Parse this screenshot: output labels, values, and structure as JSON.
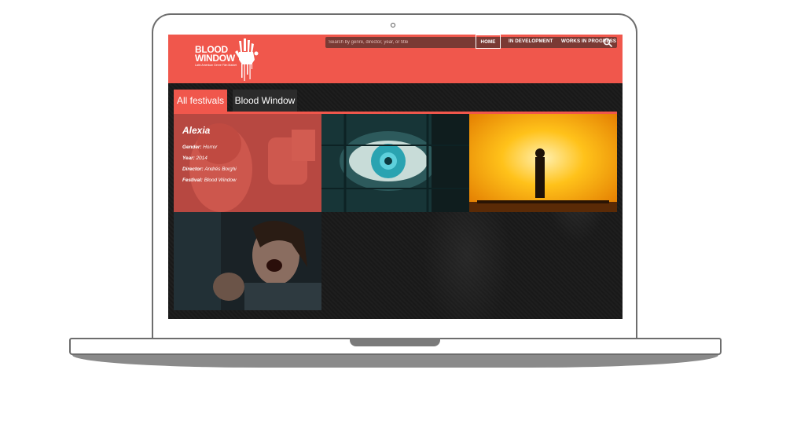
{
  "site": {
    "logo_title": "BLOOD\nWINDOW",
    "logo_tagline": "Latin American Genre Film Market",
    "search_placeholder": "Search by genre, director, year, or title"
  },
  "nav": [
    {
      "label": "HOME",
      "active": true
    },
    {
      "label": "IN DEVELOPMENT",
      "active": false
    },
    {
      "label": "WORKS IN PROGRESS",
      "active": false
    }
  ],
  "tabs": [
    {
      "label": "All festivals",
      "active": true
    },
    {
      "label": "Blood Window",
      "active": false
    }
  ],
  "films": [
    {
      "title": "Alexia",
      "gender_label": "Gender:",
      "gender": "Horror",
      "year_label": "Year:",
      "year": "2014",
      "director_label": "Director:",
      "director": "Andrés Borghi",
      "festival_label": "Festival:",
      "festival": "Blood Window"
    }
  ],
  "colors": {
    "brand": "#f0574c",
    "dark_bg": "#1b1b1b"
  }
}
